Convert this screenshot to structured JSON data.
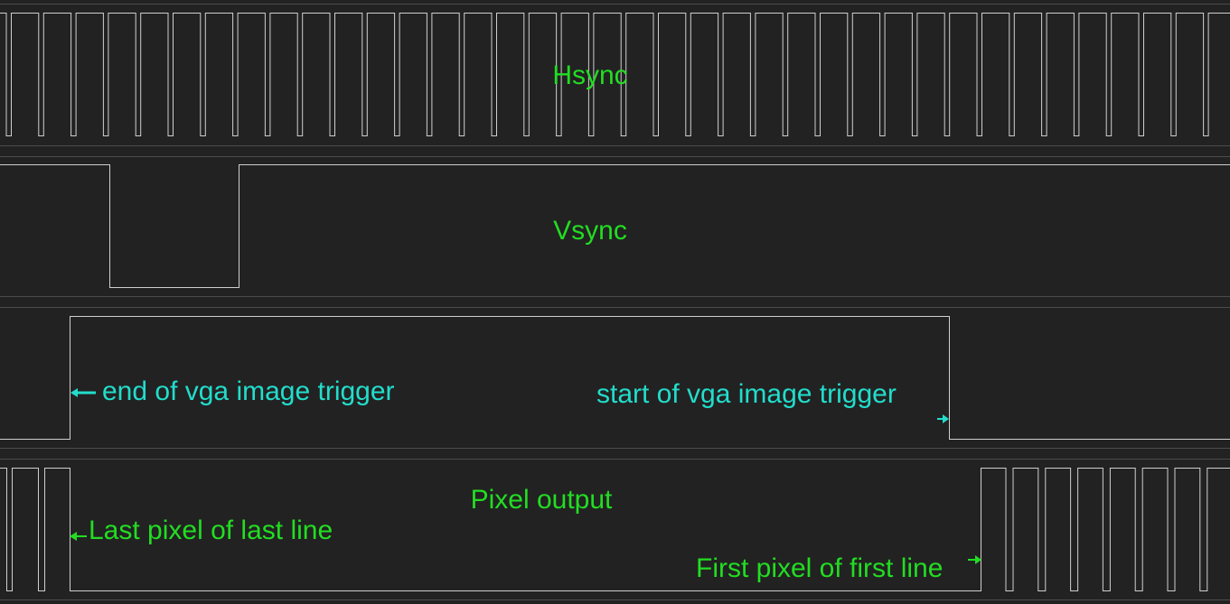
{
  "colors": {
    "background": "#222222",
    "lane_border": "#4c4c4c",
    "wave": "#cfcfcf",
    "signal_label": "#22dd22",
    "trigger_annotation": "#22ddcc",
    "pixel_annotation": "#22dd22"
  },
  "lanes": {
    "hsync": {
      "label": "Hsync"
    },
    "vsync": {
      "label": "Vsync"
    },
    "trigger": {
      "end_label": "end of vga image trigger",
      "start_label": "start of vga image trigger"
    },
    "pixel": {
      "label": "Pixel output",
      "last_label": "Last pixel of last line",
      "first_label": "First pixel of first line"
    }
  }
}
